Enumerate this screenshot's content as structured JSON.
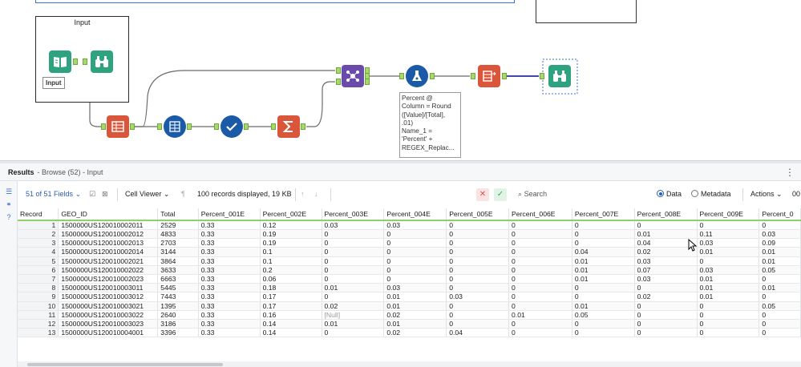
{
  "canvas": {
    "container_title": "Input",
    "input_label": "Input",
    "annotation_lines": [
      "Percent @",
      "Column = Round",
      "([Value]/[Total],",
      ".01)",
      "Name_1 =",
      "'Percent' +",
      "REGEX_Replac..."
    ],
    "tools": [
      {
        "name": "input-data-tool",
        "icon": "book-icon",
        "color": "#2fa37f"
      },
      {
        "name": "browse-tool-input",
        "icon": "binoculars-icon",
        "color": "#2fa37f"
      },
      {
        "name": "transpose-tool",
        "icon": "transpose-icon",
        "color": "#d9563a"
      },
      {
        "name": "data-cleansing-tool",
        "icon": "cleanse-icon",
        "color": "#1a5aa6"
      },
      {
        "name": "select-tool",
        "icon": "checkmark-icon",
        "color": "#1a5aa6"
      },
      {
        "name": "summarize-tool",
        "icon": "sigma-icon",
        "color": "#d9563a"
      },
      {
        "name": "join-tool",
        "icon": "join-icon",
        "color": "#6a4aaa"
      },
      {
        "name": "formula-tool",
        "icon": "flask-icon",
        "color": "#1a5aa6"
      },
      {
        "name": "cross-tab-tool",
        "icon": "crosstab-icon",
        "color": "#d9563a"
      },
      {
        "name": "browse-tool-output",
        "icon": "binoculars-icon",
        "color": "#2fa37f"
      }
    ],
    "join_anchor_labels": [
      "L",
      "R",
      "J",
      "L",
      "R"
    ]
  },
  "results": {
    "title": "Results",
    "subtitle": "- Browse (52) - Input",
    "menu_icon": "ellipsis-vertical-icon"
  },
  "toolbar": {
    "fields_label": "51 of 51 Fields",
    "cell_viewer_label": "Cell Viewer",
    "records_info": "100 records displayed, 19 KB",
    "search_placeholder": "Search",
    "data_label": "Data",
    "metadata_label": "Metadata",
    "actions_label": "Actions",
    "trailing_text": "00",
    "data_selected": true
  },
  "table": {
    "columns": [
      "Record",
      "GEO_ID",
      "Total",
      "Percent_001E",
      "Percent_002E",
      "Percent_003E",
      "Percent_004E",
      "Percent_005E",
      "Percent_006E",
      "Percent_007E",
      "Percent_008E",
      "Percent_009E",
      "Percent_0"
    ],
    "rows": [
      [
        "1",
        "1500000US120010002011",
        "2529",
        "0.33",
        "0.12",
        "0.03",
        "0.03",
        "0",
        "0",
        "0",
        "0",
        "0",
        "0"
      ],
      [
        "2",
        "1500000US120010002012",
        "4833",
        "0.33",
        "0.19",
        "0",
        "0",
        "0",
        "0",
        "0",
        "0.01",
        "0.11",
        "0.03"
      ],
      [
        "3",
        "1500000US120010002013",
        "2703",
        "0.33",
        "0.19",
        "0",
        "0",
        "0",
        "0",
        "0",
        "0.04",
        "0.03",
        "0.09"
      ],
      [
        "4",
        "1500000US120010002014",
        "3144",
        "0.33",
        "0.1",
        "0",
        "0",
        "0",
        "0",
        "0.04",
        "0.02",
        "0.01",
        "0.01"
      ],
      [
        "5",
        "1500000US120010002021",
        "3864",
        "0.33",
        "0.1",
        "0",
        "0",
        "0",
        "0",
        "0.01",
        "0.03",
        "0",
        "0.01"
      ],
      [
        "6",
        "1500000US120010002022",
        "3633",
        "0.33",
        "0.2",
        "0",
        "0",
        "0",
        "0",
        "0.01",
        "0.07",
        "0.03",
        "0.05"
      ],
      [
        "7",
        "1500000US120010002023",
        "6663",
        "0.33",
        "0.06",
        "0",
        "0",
        "0",
        "0",
        "0.01",
        "0.03",
        "0.01",
        "0"
      ],
      [
        "8",
        "1500000US120010003011",
        "5445",
        "0.33",
        "0.18",
        "0.01",
        "0.03",
        "0",
        "0",
        "0",
        "0",
        "0.01",
        "0.01"
      ],
      [
        "9",
        "1500000US120010003012",
        "7443",
        "0.33",
        "0.17",
        "0",
        "0.01",
        "0.03",
        "0",
        "0",
        "0.02",
        "0.01",
        "0"
      ],
      [
        "10",
        "1500000US120010003021",
        "1395",
        "0.33",
        "0.17",
        "0.02",
        "0.01",
        "0",
        "0",
        "0.01",
        "0",
        "0",
        "0.05"
      ],
      [
        "11",
        "1500000US120010003022",
        "2640",
        "0.33",
        "0.16",
        "[Null]",
        "0.02",
        "0",
        "0.01",
        "0.05",
        "0",
        "0",
        "0"
      ],
      [
        "12",
        "1500000US120010003023",
        "3186",
        "0.33",
        "0.14",
        "0.01",
        "0.01",
        "0",
        "0",
        "0",
        "0",
        "0",
        "0"
      ],
      [
        "13",
        "1500000US120010004001",
        "3396",
        "0.33",
        "0.14",
        "0",
        "0.02",
        "0.04",
        "0",
        "0",
        "0",
        "0",
        "0"
      ]
    ]
  },
  "colors": {
    "accent_blue": "#2a5db0",
    "header_underline": "#8ed06a",
    "cancel_red": "#d9534f",
    "apply_green": "#3fa85a"
  }
}
